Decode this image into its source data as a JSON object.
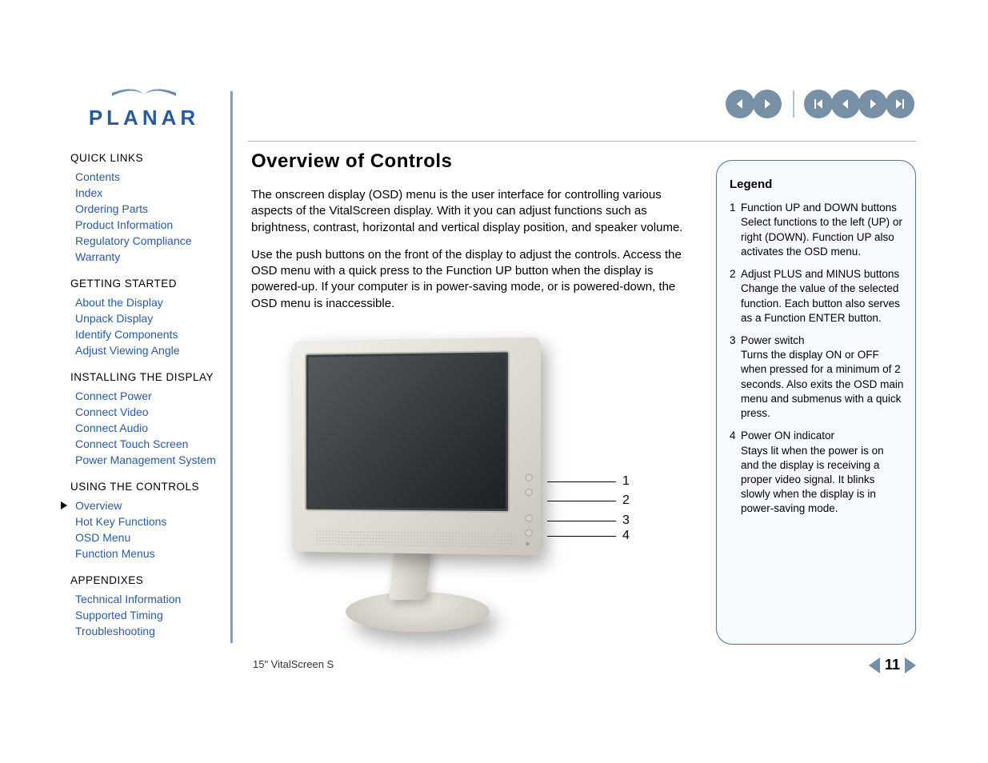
{
  "brand": "PLANAR",
  "sidebar": [
    {
      "heading": "QUICK LINKS",
      "links": [
        "Contents",
        "Index",
        "Ordering Parts",
        "Product Information",
        "Regulatory Compliance",
        "Warranty"
      ]
    },
    {
      "heading": "GETTING STARTED",
      "links": [
        "About the Display",
        "Unpack Display",
        "Identify Components",
        "Adjust Viewing Angle"
      ]
    },
    {
      "heading": "INSTALLING THE DISPLAY",
      "links": [
        "Connect Power",
        "Connect Video",
        "Connect Audio",
        "Connect Touch Screen",
        "Power Management System"
      ]
    },
    {
      "heading": "USING THE CONTROLS",
      "links": [
        "Overview",
        "Hot Key Functions",
        "OSD Menu",
        "Function Menus"
      ],
      "activeIndex": 0
    },
    {
      "heading": "APPENDIXES",
      "links": [
        "Technical Information",
        "Supported Timing",
        "Troubleshooting"
      ]
    }
  ],
  "main": {
    "title": "Overview of Controls",
    "p1": "The onscreen display (OSD) menu is the user interface for controlling various aspects of the VitalScreen display.  With it you can adjust functions such as brightness, contrast, horizontal and vertical display position, and speaker volume.",
    "p2": "Use the push buttons on the front of the display to adjust the controls. Access the OSD menu with a quick press to the Function UP button when the display is powered-up. If your computer is in power-saving mode, or is powered-down, the OSD menu is inaccessible."
  },
  "callouts": [
    "1",
    "2",
    "3",
    "4"
  ],
  "legend": {
    "title": "Legend",
    "items": [
      {
        "num": "1",
        "lead": "Function UP and DOWN buttons",
        "desc": "Select functions to the left (UP) or right (DOWN). Function UP also activates the OSD menu."
      },
      {
        "num": "2",
        "lead": "Adjust PLUS and MINUS buttons",
        "desc": " Change the value of the selected function. Each button also serves as a Function ENTER button."
      },
      {
        "num": "3",
        "lead": "Power switch",
        "desc": "Turns the display ON or OFF when pressed for a minimum of 2 seconds. Also exits the OSD main menu and submenus with a quick press."
      },
      {
        "num": "4",
        "lead": "Power ON indicator",
        "desc": "Stays lit when the power is on and the display is receiving a proper video signal. It blinks slowly when the display is in power-saving mode."
      }
    ]
  },
  "footer": {
    "product": "15\" VitalScreen S",
    "page": "11"
  }
}
